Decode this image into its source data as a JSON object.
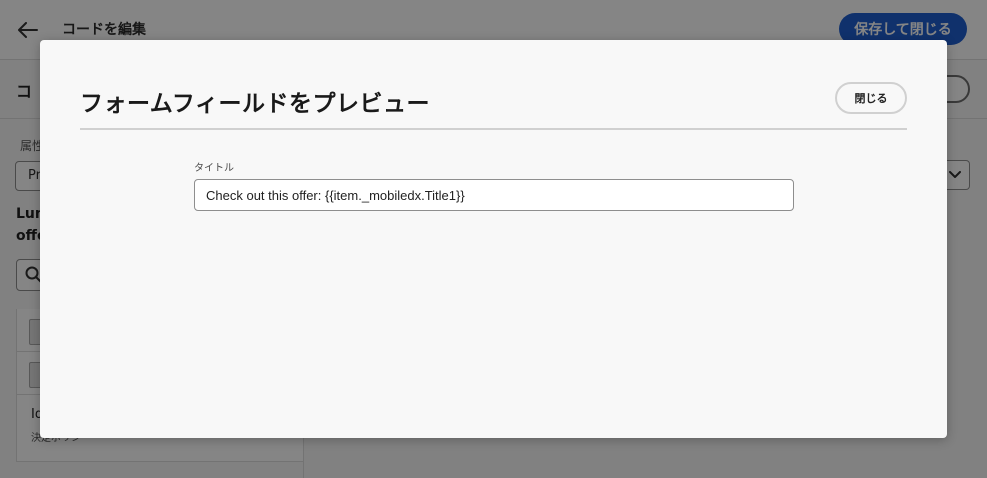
{
  "app": {
    "title": "コードを編集",
    "primary_button": "保存して閉じる",
    "subheader_title": "コ",
    "attribute_label": "属性",
    "attribute_value": "Pr",
    "offer_name_line1": "Lum",
    "offer_name_line2": "offe",
    "list_item_id": "Id",
    "list_item_sub": "決定ポリシー"
  },
  "icons": {
    "back": "arrow-left-icon",
    "search": "search-icon",
    "chevron": "chevron-down-icon",
    "thumb": "offer-thumbnail-icon"
  },
  "modal": {
    "title": "フォームフィールドをプレビュー",
    "close_label": "閉じる",
    "field": {
      "label": "タイトル",
      "value": "Check out this offer: {{item._mobiledx.Title1}}"
    }
  },
  "colors": {
    "accent": "#1f5fcf",
    "overlay": "rgba(0,0,0,0.48)",
    "modal_background": "#f8f8f8"
  }
}
